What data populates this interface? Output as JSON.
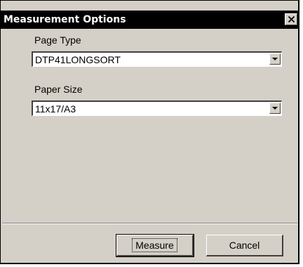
{
  "dialog": {
    "title": "Measurement Options",
    "close_icon": "close-x-icon"
  },
  "page_type": {
    "label": "Page Type",
    "selected": "DTP41LONGSORT",
    "arrow_icon": "chevron-down-icon"
  },
  "paper_size": {
    "label": "Paper Size",
    "selected": "11x17/A3",
    "arrow_icon": "chevron-down-icon"
  },
  "buttons": {
    "measure_label": "Measure",
    "cancel_label": "Cancel"
  }
}
